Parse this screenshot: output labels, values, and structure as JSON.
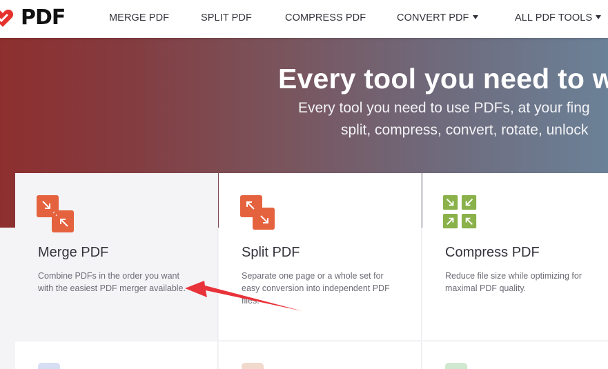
{
  "brand": {
    "logo_text": "PDF",
    "accent": "#e5322d"
  },
  "nav": {
    "items": [
      {
        "label": "MERGE PDF",
        "has_caret": false
      },
      {
        "label": "SPLIT PDF",
        "has_caret": false
      },
      {
        "label": "COMPRESS PDF",
        "has_caret": false
      },
      {
        "label": "CONVERT PDF",
        "has_caret": true
      },
      {
        "label": "ALL PDF TOOLS",
        "has_caret": true
      }
    ]
  },
  "hero": {
    "title": "Every tool you need to w",
    "subtitle_line1": "Every tool you need to use PDFs, at your fing",
    "subtitle_line2": "split, compress, convert, rotate, unlock"
  },
  "tools": [
    {
      "title": "Merge PDF",
      "desc": "Combine PDFs in the order you want with the easiest PDF merger available.",
      "icon": "merge-icon",
      "color": "#e5623e"
    },
    {
      "title": "Split PDF",
      "desc": "Separate one page or a whole set for easy conversion into independent PDF files.",
      "icon": "split-icon",
      "color": "#e5623e"
    },
    {
      "title": "Compress PDF",
      "desc": "Reduce file size while optimizing for maximal PDF quality.",
      "icon": "compress-icon",
      "color": "#8ab14a"
    }
  ],
  "row2_colors": [
    "#d6def4",
    "#f1d9cc",
    "#cfe8cf"
  ]
}
